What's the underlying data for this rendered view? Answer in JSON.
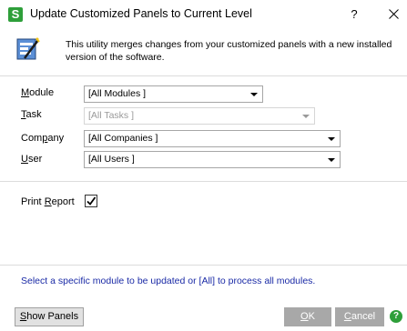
{
  "window": {
    "app_icon_letter": "S",
    "title": "Update Customized Panels to Current Level",
    "help_glyph": "?"
  },
  "header": {
    "description": "This utility merges changes from your customized panels with a new installed version of the software."
  },
  "form": {
    "module": {
      "label": "Module",
      "value": "[All Modules ]"
    },
    "task": {
      "label": "Task",
      "value": "[All Tasks ]"
    },
    "company": {
      "label": "Company",
      "value": "[All Companies ]"
    },
    "user": {
      "label": "User",
      "value": "[All Users ]"
    },
    "print_report": {
      "label": "Print Report",
      "checked": true
    }
  },
  "status": {
    "message": "Select a specific module to be updated or [All] to process all modules."
  },
  "buttons": {
    "show_panels": "Show Panels",
    "ok": "OK",
    "cancel": "Cancel",
    "help": "?"
  },
  "colors": {
    "brand_green": "#2e9f3a",
    "status_text": "#1a2aa6"
  }
}
